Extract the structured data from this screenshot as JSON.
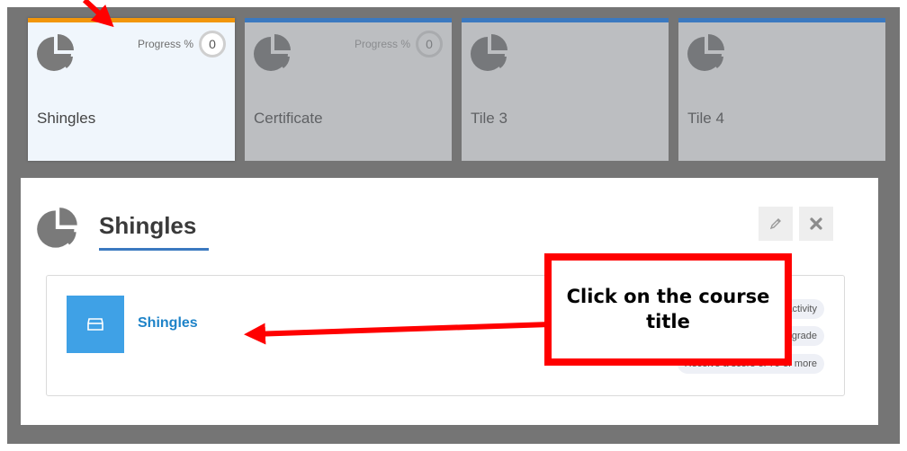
{
  "tiles": [
    {
      "title": "Shingles",
      "progress_label": "Progress %",
      "progress_value": "0",
      "active": true
    },
    {
      "title": "Certificate",
      "progress_label": "Progress %",
      "progress_value": "0",
      "active": false
    },
    {
      "title": "Tile 3",
      "active": false
    },
    {
      "title": "Tile 4",
      "active": false
    }
  ],
  "panel": {
    "title": "Shingles",
    "course": {
      "title": "Shingles"
    },
    "requirements": [
      "activity",
      "a grade",
      "Receive a score of 79 or more"
    ]
  },
  "annotation": {
    "callout_text": "Click on the course title"
  },
  "colors": {
    "accent_blue": "#3b79c0",
    "active_tile_border": "#f2960b",
    "annotation_red": "#ff0000",
    "course_icon": "#3fa1e6",
    "link": "#1e83c8"
  },
  "icons": {
    "tile_icon": "pie-chart-icon",
    "edit": "pencil-icon",
    "close": "close-icon",
    "course": "box-icon"
  }
}
